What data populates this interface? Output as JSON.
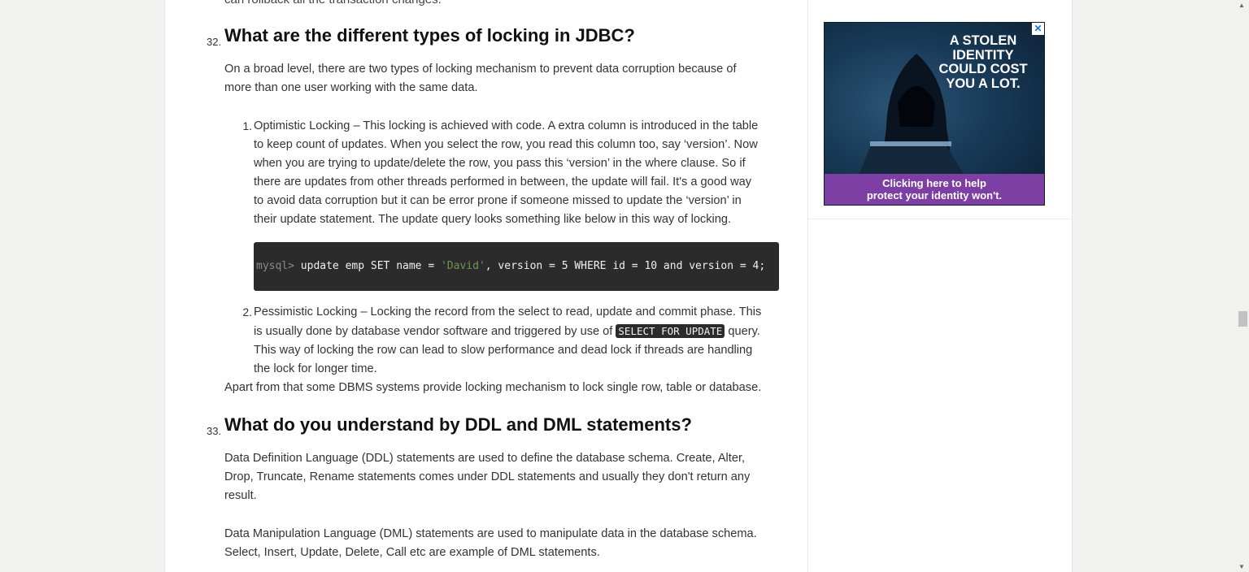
{
  "article": {
    "cut_line": "can rollback all the transaction changes.",
    "q32": {
      "number": "32.",
      "title": "What are the different types of locking in JDBC?",
      "intro_line1": "On a broad level, there are two types of locking mechanism to prevent data corruption because of",
      "intro_line2": "more than one user working with the same data.",
      "item1": {
        "number": "1.",
        "lines": [
          "Optimistic Locking – This locking is achieved with code. A extra column is introduced in the table",
          "to keep count of updates. When you select the row, you read this column too, say ‘version’. Now",
          "when you are trying to update/delete the row, you pass this ‘version’ in the where clause. So if",
          "there are updates from other threads performed in between, the update will fail. It's a good way",
          "to avoid data corruption but it can be error prone if someone missed to update the ‘version’ in",
          "their update statement. The update query looks something like below in this way of locking."
        ]
      },
      "code": {
        "prompt": "mysql>",
        "part1": " update emp SET name = ",
        "string": "'David'",
        "part2": ", version = 5 WHERE id = 10 and version = 4;"
      },
      "item2": {
        "number": "2.",
        "line1": "Pessimistic Locking – Locking the record from the select to read, update and commit phase. This",
        "line2_pre": "is usually done by database vendor software and triggered by use of ",
        "line2_code": "SELECT FOR UPDATE",
        "line2_post": " query.",
        "line3": "This way of locking the row can lead to slow performance and dead lock if threads are handling",
        "line4": "the lock for longer time."
      },
      "outro": "Apart from that some DBMS systems provide locking mechanism to lock single row, table or database."
    },
    "q33": {
      "number": "33.",
      "title": "What do you understand by DDL and DML statements?",
      "p1_line1": "Data Definition Language (DDL) statements are used to define the database schema. Create, Alter,",
      "p1_line2": "Drop, Truncate, Rename statements comes under DDL statements and usually they don't return any",
      "p1_line3": "result.",
      "p2_line1": "Data Manipulation Language (DML) statements are used to manipulate data in the database schema.",
      "p2_line2": "Select, Insert, Update, Delete, Call etc are example of DML statements."
    }
  },
  "ad": {
    "headline_lines": [
      "A STOLEN",
      "IDENTITY",
      "COULD COST",
      "YOU A LOT."
    ],
    "footer_line1": "Clicking here to help",
    "footer_line2": "protect your identity won't.",
    "close_glyph": "✕",
    "footer_color": "#7e3fa4"
  },
  "scrollbar": {
    "up_glyph": "▲",
    "down_glyph": "▼"
  }
}
